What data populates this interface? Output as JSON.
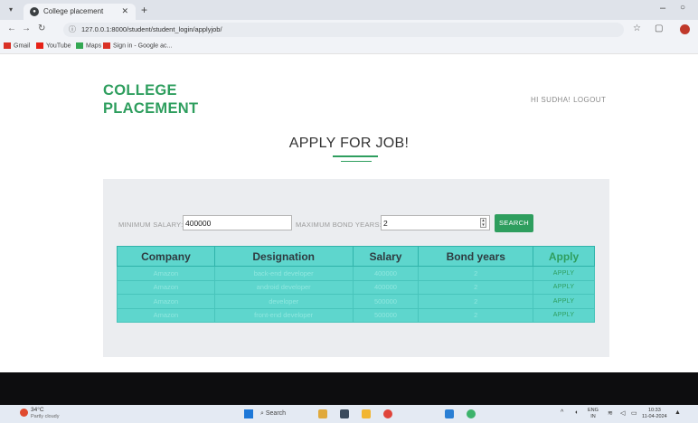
{
  "browser": {
    "tab_title": "College placement",
    "url": "127.0.0.1:8000/student/student_login/applyjob/",
    "bookmarks": [
      "Gmail",
      "YouTube",
      "Maps",
      "Sign in - Google ac..."
    ]
  },
  "header": {
    "brand_line1": "COLLEGE",
    "brand_line2": "PLACEMENT",
    "greeting": "HI SUDHA!",
    "logout": "LOGOUT"
  },
  "page": {
    "title": "APPLY FOR JOB!"
  },
  "filters": {
    "min_salary_label": "MINIMUM SALARY:",
    "min_salary_value": "400000",
    "max_bond_label": "MAXIMUM BOND YEARS:",
    "max_bond_value": "2",
    "search_label": "SEARCH"
  },
  "table": {
    "headers": [
      "Company",
      "Designation",
      "Salary",
      "Bond years",
      "Apply"
    ],
    "rows": [
      [
        "Amazon",
        "back-end developer",
        "400000",
        "2",
        "APPLY"
      ],
      [
        "Amazon",
        "android developer",
        "400000",
        "2",
        "APPLY"
      ],
      [
        "Amazon",
        "developer",
        "500000",
        "2",
        "APPLY"
      ],
      [
        "Amazon",
        "front-end developer",
        "500000",
        "2",
        "APPLY"
      ]
    ]
  },
  "taskbar": {
    "temp": "34°C",
    "weather": "Partly cloudy",
    "search": "Search",
    "lang1": "ENG",
    "lang2": "IN",
    "time": "10:33",
    "date": "11-04-2024"
  },
  "colors": {
    "accent": "#2e9e5e",
    "table_bg": "#5ed6cd"
  }
}
